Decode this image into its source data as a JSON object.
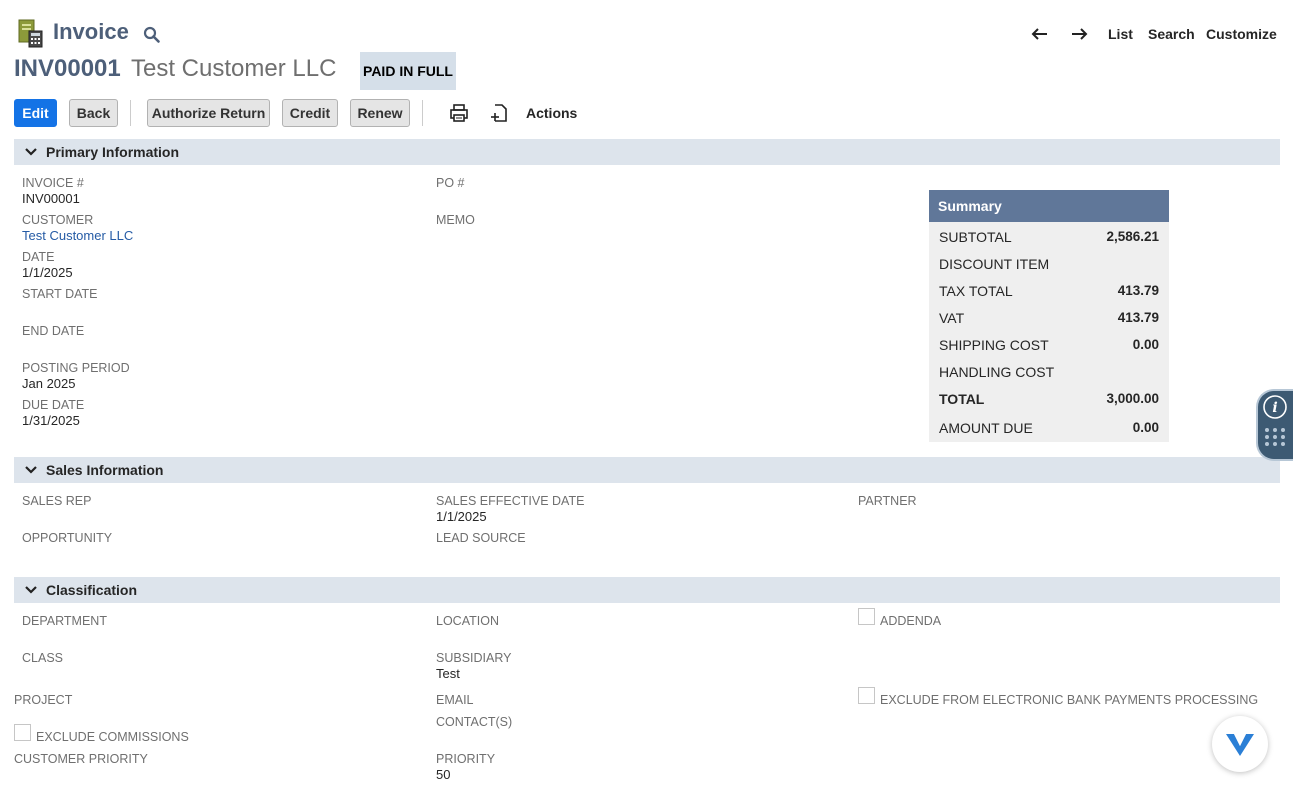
{
  "header": {
    "page_type": "Invoice",
    "record_id": "INV00001",
    "record_name": "Test Customer LLC",
    "status": "PAID IN FULL",
    "nav": {
      "list": "List",
      "search": "Search",
      "customize": "Customize"
    }
  },
  "toolbar": {
    "edit": "Edit",
    "back": "Back",
    "authorize_return": "Authorize Return",
    "credit": "Credit",
    "renew": "Renew",
    "actions": "Actions"
  },
  "primary": {
    "title": "Primary Information",
    "invoice_label": "INVOICE #",
    "invoice_value": "INV00001",
    "customer_label": "CUSTOMER",
    "customer_value": "Test Customer LLC",
    "date_label": "DATE",
    "date_value": "1/1/2025",
    "start_date_label": "START DATE",
    "end_date_label": "END DATE",
    "posting_period_label": "POSTING PERIOD",
    "posting_period_value": "Jan 2025",
    "due_date_label": "DUE DATE",
    "due_date_value": "1/31/2025",
    "po_label": "PO #",
    "memo_label": "MEMO"
  },
  "summary": {
    "title": "Summary",
    "rows": [
      {
        "label": "SUBTOTAL",
        "value": "2,586.21"
      },
      {
        "label": "DISCOUNT ITEM",
        "value": ""
      },
      {
        "label": "TAX TOTAL",
        "value": "413.79"
      },
      {
        "label": "VAT",
        "value": "413.79"
      },
      {
        "label": "SHIPPING COST",
        "value": "0.00"
      },
      {
        "label": "HANDLING COST",
        "value": ""
      },
      {
        "label": "TOTAL",
        "value": "3,000.00"
      },
      {
        "label": "AMOUNT DUE",
        "value": "0.00"
      }
    ]
  },
  "sales": {
    "title": "Sales Information",
    "sales_rep_label": "SALES REP",
    "opportunity_label": "OPPORTUNITY",
    "sales_effective_date_label": "SALES EFFECTIVE DATE",
    "sales_effective_date_value": "1/1/2025",
    "lead_source_label": "LEAD SOURCE",
    "partner_label": "PARTNER"
  },
  "classification": {
    "title": "Classification",
    "department_label": "DEPARTMENT",
    "class_label": "CLASS",
    "project_label": "PROJECT",
    "exclude_commissions_label": "EXCLUDE COMMISSIONS",
    "customer_priority_label": "CUSTOMER PRIORITY",
    "location_label": "LOCATION",
    "subsidiary_label": "SUBSIDIARY",
    "subsidiary_value": "Test",
    "email_label": "EMAIL",
    "contacts_label": "CONTACT(S)",
    "priority_label": "PRIORITY",
    "priority_value": "50",
    "addenda_label": "ADDENDA",
    "exclude_bank_label": "EXCLUDE FROM ELECTRONIC BANK PAYMENTS PROCESSING"
  }
}
